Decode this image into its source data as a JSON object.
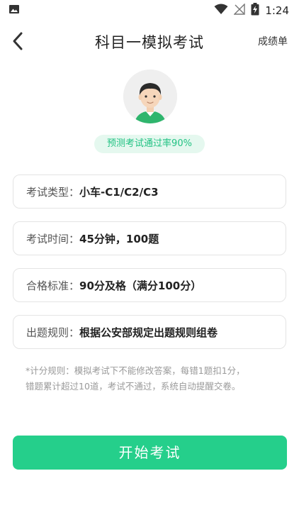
{
  "status_bar": {
    "time": "1:24",
    "icons": [
      "image-icon",
      "wifi-icon",
      "signal-icon",
      "battery-charging-icon"
    ]
  },
  "nav": {
    "title": "科目一模拟考试",
    "right_action": "成绩单",
    "back_icon": "chevron-left-icon"
  },
  "profile": {
    "avatar_icon": "user-avatar-icon",
    "pass_rate_text": "预测考试通过率90%"
  },
  "info_items": [
    {
      "label": "考试类型：",
      "value": "小车-C1/C2/C3"
    },
    {
      "label": "考试时间：",
      "value": "45分钟，100题"
    },
    {
      "label": "合格标准：",
      "value": "90分及格（满分100分）"
    },
    {
      "label": "出题规则：",
      "value": "根据公安部规定出题规则组卷"
    }
  ],
  "scoring_note_line1": "*计分规则：模拟考试下不能修改答案，每错1题扣1分，",
  "scoring_note_line2": "错题累计超过10道，考试不通过，系统自动提醒交卷。",
  "start_button": "开始考试",
  "colors": {
    "accent": "#25cf8b",
    "pill_bg": "#e5f8ef",
    "pill_text": "#21c283"
  }
}
